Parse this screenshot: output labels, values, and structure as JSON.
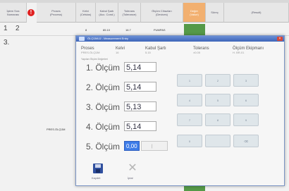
{
  "header": {
    "col0": "İşlem Sıra\nNumarası",
    "col1": "Proses\n(Process)",
    "col2": "Kelvi\n(Celsius)",
    "col3": "Kabul Şartı\n(Acc. Cond.)",
    "col4": "Tolerans\n(Tolerance)",
    "col5": "Ölçüm Cihazları\n(Devices)",
    "col6": "Değer\n(Value)",
    "col7": "Süreç",
    "col8": "(Result)"
  },
  "rows": {
    "r1a": "1",
    "r1b": "2",
    "r3": "3.",
    "row1_values": [
      "8",
      "85.10",
      "16.7",
      "PUMPAS"
    ],
    "process_label": "PRES.ÖLÇÜM"
  },
  "dialog": {
    "title": "ÖLÇÜMLÜ - Measurement Entry",
    "close": "×",
    "info": {
      "h_proses": "Proses",
      "v_proses": "PRES.ÖLÇÜM",
      "h_kelvi": "Kelvi",
      "v_kelvi": "16",
      "h_kabul": "Kabul Şartı",
      "v_kabul": "5.15",
      "h_tolerans": "Tolerans",
      "v_tolerans": "±0.05",
      "h_olcum": "Ölçüm Ekipmanı",
      "v_olcum": "H. BR-01"
    },
    "subheader": "Yapılan Ölçüm Değerleri",
    "measurements": [
      {
        "label": "1. Ölçüm",
        "value": "5,14"
      },
      {
        "label": "2. Ölçüm",
        "value": "5,14"
      },
      {
        "label": "3. Ölçüm",
        "value": "5,13"
      },
      {
        "label": "4. Ölçüm",
        "value": "5,14"
      },
      {
        "label": "5. Ölçüm",
        "value": "0,00"
      }
    ],
    "keypad": [
      "1",
      "2",
      "3",
      "4",
      "5",
      "6",
      "7",
      "8",
      "9",
      "0",
      "",
      "⌫"
    ],
    "save_label": "Kaydet",
    "cancel_label": "İptal"
  }
}
